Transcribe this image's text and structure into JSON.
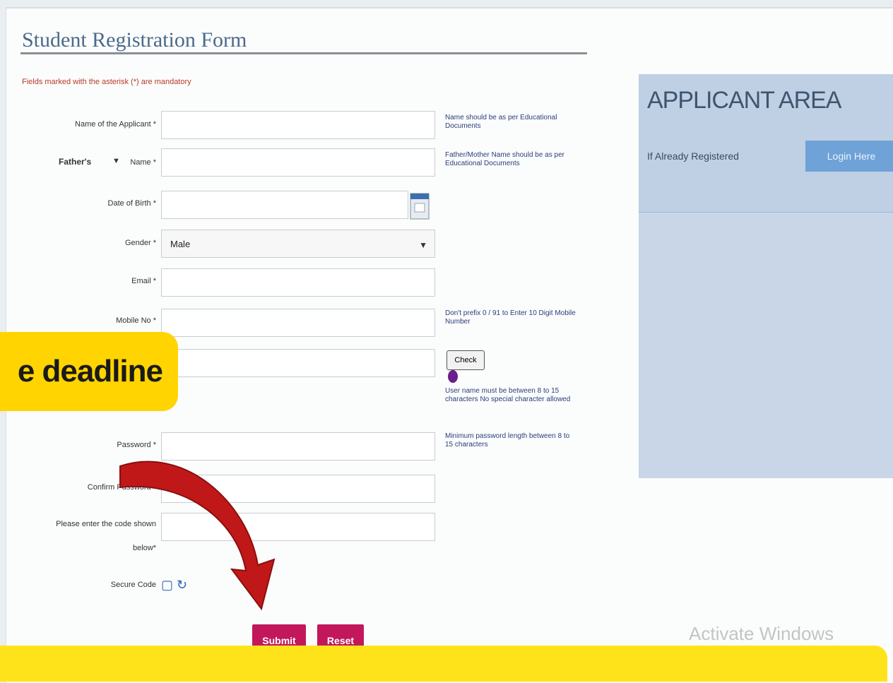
{
  "form": {
    "title": "Student  Registration Form",
    "mandatory_note": "Fields marked with the asterisk (*) are mandatory",
    "fields": {
      "name_label": "Name of the Applicant *",
      "name_note": "Name should be as per Educational Documents",
      "father_label": "Father's",
      "father_select_arrow": "▼",
      "father_name_label": "Name *",
      "father_note": "Father/Mother Name should be as per Educational Documents",
      "dob_label": "Date of Birth *",
      "gender_label": "Gender *",
      "gender_value": "Male",
      "email_label": "Email *",
      "mobile_label": "Mobile No *",
      "mobile_note": "Don't prefix 0 / 91 to Enter 10 Digit Mobile Number",
      "check_button": "Check",
      "username_note": "User name must be between 8 to 15 characters No special character allowed",
      "password_label": "Password *",
      "password_note": "Minimum password length between 8 to 15 characters",
      "confirm_label": "Confirm Password *",
      "code_label_line1": "Please enter the code shown",
      "code_label_line2": "below*",
      "secure_code_label": "Secure Code"
    },
    "buttons": {
      "submit": "Submit",
      "reset": "Reset"
    }
  },
  "overlay": {
    "badge_text": "e deadline"
  },
  "applicant_area": {
    "title": "APPLICANT AREA",
    "registered_text": "If Already Registered",
    "login_button": "Login Here"
  },
  "watermark": "Activate Windows",
  "colors": {
    "accent_button": "#c2185b",
    "badge_yellow": "#ffd400",
    "panel_blue": "#c8d6e8",
    "arrow_red": "#c01818"
  }
}
